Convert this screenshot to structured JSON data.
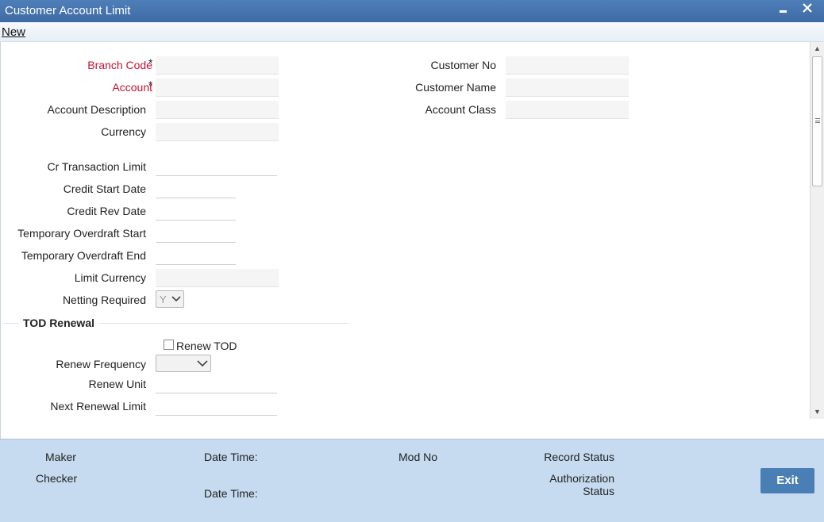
{
  "window": {
    "title": "Customer Account Limit",
    "minimize_glyph": "▬",
    "close_glyph": "✕"
  },
  "toolbar": {
    "new_label": "New"
  },
  "form": {
    "branch_code": {
      "label": "Branch Code",
      "required_mark": "*",
      "value": ""
    },
    "account": {
      "label": "Account",
      "required_mark": "*",
      "value": ""
    },
    "account_description": {
      "label": "Account Description",
      "value": ""
    },
    "currency": {
      "label": "Currency",
      "value": ""
    },
    "customer_no": {
      "label": "Customer No",
      "value": ""
    },
    "customer_name": {
      "label": "Customer Name",
      "value": ""
    },
    "account_class": {
      "label": "Account Class",
      "value": ""
    },
    "cr_transaction_limit": {
      "label": "Cr Transaction Limit",
      "value": ""
    },
    "credit_start_date": {
      "label": "Credit Start Date",
      "value": ""
    },
    "credit_rev_date": {
      "label": "Credit Rev Date",
      "value": ""
    },
    "temporary_overdraft_start": {
      "label": "Temporary Overdraft Start",
      "value": ""
    },
    "temporary_overdraft_end": {
      "label": "Temporary Overdraft End",
      "value": ""
    },
    "limit_currency": {
      "label": "Limit Currency",
      "value": ""
    },
    "netting_required": {
      "label": "Netting Required",
      "value": "Y"
    }
  },
  "tod_renewal": {
    "section_title": "TOD Renewal",
    "renew_tod": {
      "label": "Renew TOD",
      "checked": false
    },
    "renew_frequency": {
      "label": "Renew Frequency",
      "value": ""
    },
    "renew_unit": {
      "label": "Renew Unit",
      "value": ""
    },
    "next_renewal_limit": {
      "label": "Next Renewal Limit",
      "value": ""
    }
  },
  "footer": {
    "maker_label": "Maker",
    "checker_label": "Checker",
    "maker_datetime_label": "Date Time:",
    "checker_datetime_label": "Date Time:",
    "mod_no_label": "Mod No",
    "record_status_label": "Record Status",
    "authorization_status_line1": "Authorization",
    "authorization_status_line2": "Status",
    "exit_label": "Exit"
  },
  "icons": {
    "chevron": "chevron-down-icon",
    "scroll_up": "triangle-up-icon",
    "scroll_down": "triangle-down-icon"
  }
}
